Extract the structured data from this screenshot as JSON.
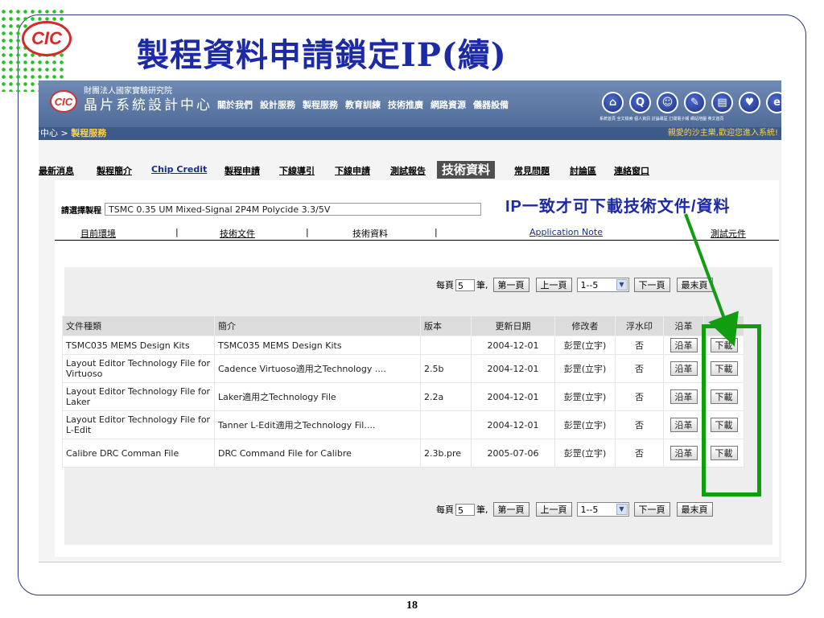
{
  "slide": {
    "logo_text": "CIC",
    "title": "製程資料申請鎖定IP(續)",
    "page_number": "18"
  },
  "colors": {
    "title": "#1c2aa6",
    "highlight": "#109d10",
    "banner": "#4f6c99"
  },
  "site": {
    "org_line": "財團法人國家實驗研究院",
    "name": "晶片系統設計中心",
    "logo_text": "CIC",
    "nav": [
      "關於我們",
      "設計服務",
      "製程服務",
      "教育訓練",
      "技術推廣",
      "網路資源",
      "儀器設備"
    ],
    "icons": [
      {
        "name": "home-icon",
        "glyph": "⌂"
      },
      {
        "name": "search-icon",
        "glyph": "Q"
      },
      {
        "name": "person-icon",
        "glyph": "☺"
      },
      {
        "name": "discussion-icon",
        "glyph": "✎"
      },
      {
        "name": "book-icon",
        "glyph": "▤"
      },
      {
        "name": "shirt-icon",
        "glyph": "♥"
      },
      {
        "name": "english-icon",
        "glyph": "e"
      }
    ],
    "icon_labels": "系統首頁 全文檢索 個人資訊 討論專區 訂閱電子報 網站地圖 英文首頁",
    "breadcrumb_root": "晶片中心",
    "breadcrumb_sep": " > ",
    "breadcrumb_current": "製程服務",
    "welcome": "親愛的沙主樂,歡迎您進入系統!"
  },
  "tabs": [
    "最新消息",
    "製程簡介",
    "Chip Credit",
    "製程申請",
    "下線導引",
    "下線申請",
    "測試報告",
    "技術資料",
    "常見問題",
    "討論區",
    "連絡窗口"
  ],
  "process": {
    "label": "請選擇製程",
    "value": "TSMC 0.35 UM Mixed-Signal 2P4M Polycide 3.3/5V"
  },
  "sub_tabs": {
    "items": [
      "目前環境",
      "技術文件",
      "技術資料",
      "Application Note",
      "測試元件"
    ],
    "sep": "|"
  },
  "pager": {
    "per_page_prefix": "每頁",
    "per_page_value": "5",
    "per_page_suffix": "筆,",
    "first": "第一頁",
    "prev": "上一頁",
    "range": "1--5",
    "next": "下一頁",
    "last": "最末頁"
  },
  "table": {
    "headers": [
      "文件種類",
      "簡介",
      "版本",
      "更新日期",
      "修改者",
      "浮水印",
      "沿革",
      "下載"
    ],
    "rows": [
      {
        "type": "TSMC035 MEMS Design Kits",
        "desc": "TSMC035 MEMS Design Kits",
        "version": "",
        "date": "2004-12-01",
        "editor": "彭罡(立宇)",
        "watermark": "否",
        "history": "沿革",
        "download": "下載"
      },
      {
        "type": "Layout Editor Technology File for Virtuoso",
        "desc": "Cadence Virtuoso適用之Technology ....",
        "version": "2.5b",
        "date": "2004-12-01",
        "editor": "彭罡(立宇)",
        "watermark": "否",
        "history": "沿革",
        "download": "下載"
      },
      {
        "type": "Layout Editor Technology File for Laker",
        "desc": "Laker適用之Technology File",
        "version": "2.2a",
        "date": "2004-12-01",
        "editor": "彭罡(立宇)",
        "watermark": "否",
        "history": "沿革",
        "download": "下載"
      },
      {
        "type": "Layout Editor Technology File for L-Edit",
        "desc": "Tanner L-Edit適用之Technology Fil....",
        "version": "",
        "date": "2004-12-01",
        "editor": "彭罡(立宇)",
        "watermark": "否",
        "history": "沿革",
        "download": "下載"
      },
      {
        "type": "Calibre DRC Comman File",
        "desc": "DRC Command File for Calibre",
        "version": "2.3b.pre",
        "date": "2005-07-06",
        "editor": "彭罡(立宇)",
        "watermark": "否",
        "history": "沿革",
        "download": "下載"
      }
    ]
  },
  "annotation": {
    "text": "IP一致才可下載技術文件/資料"
  }
}
